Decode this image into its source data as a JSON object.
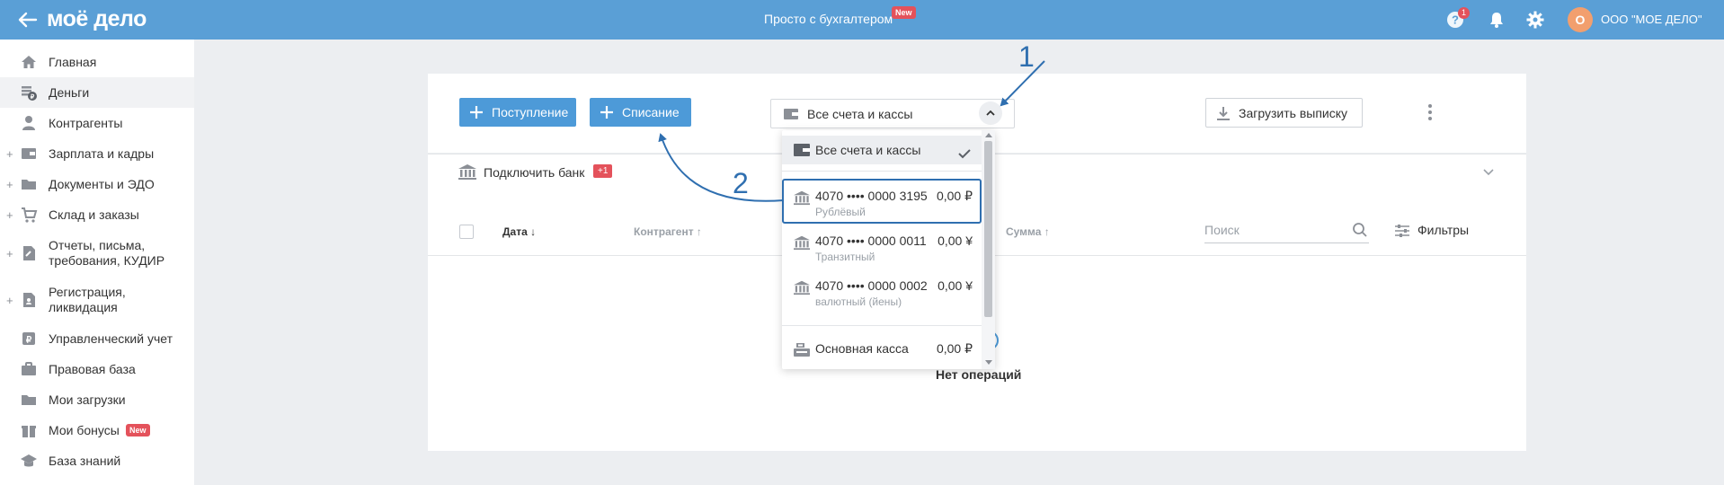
{
  "header": {
    "logo_text": "моё дело",
    "center_title": "Просто с бухгалтером",
    "center_badge": "New",
    "help_count": "1",
    "avatar_letter": "О",
    "org_name": "ООО \"МОЕ ДЕЛО\""
  },
  "sidebar": {
    "items": [
      {
        "label": "Главная",
        "icon": "home-icon"
      },
      {
        "label": "Деньги",
        "icon": "money-icon"
      },
      {
        "label": "Контрагенты",
        "icon": "contractors-icon"
      },
      {
        "label": "Зарплата и кадры",
        "icon": "payroll-icon"
      },
      {
        "label": "Документы и ЭДО",
        "icon": "documents-icon"
      },
      {
        "label": "Склад и заказы",
        "icon": "warehouse-icon"
      },
      {
        "label": "Отчеты, письма, требования, КУДИР",
        "line1": "Отчеты, письма,",
        "line2": "требования, КУДИР",
        "icon": "reports-icon"
      },
      {
        "label": "Регистрация, ликвидация",
        "line1": "Регистрация,",
        "line2": "ликвидация",
        "icon": "registration-icon"
      },
      {
        "label": "Управленческий учет",
        "icon": "management-icon"
      },
      {
        "label": "Правовая база",
        "icon": "legal-icon"
      },
      {
        "label": "Мои загрузки",
        "icon": "uploads-icon"
      },
      {
        "label": "Мои бонусы",
        "icon": "bonus-icon",
        "badge": "New"
      },
      {
        "label": "База знаний",
        "icon": "knowledge-icon"
      }
    ],
    "plus": "+"
  },
  "toolbar": {
    "income_label": "Поступление",
    "expense_label": "Списание",
    "account_select": "Все счета и кассы",
    "upload_label": "Загрузить выписку"
  },
  "bank": {
    "connect_label": "Подключить банк",
    "count_badge": "+1"
  },
  "table": {
    "columns": {
      "date": "Дата ↓",
      "contractor": "Контрагент ↑",
      "amount": "Сумма ↑"
    },
    "search_placeholder": "Поиск",
    "filters_label": "Фильтры",
    "empty_text": "Нет операций"
  },
  "dropdown": {
    "all_label": "Все счета и кассы",
    "accounts": [
      {
        "number": "4070 •••• 0000 3195",
        "type": "Рублёвый",
        "amount": "0,00 ₽"
      },
      {
        "number": "4070 •••• 0000 0011",
        "type": "Транзитный",
        "amount": "0,00 ¥"
      },
      {
        "number": "4070 •••• 0000 0002",
        "type": "валютный (йены)",
        "amount": "0,00 ¥"
      }
    ],
    "cash": {
      "name": "Основная касса",
      "amount": "0,00 ₽"
    }
  },
  "annotations": {
    "one": "1",
    "two": "2"
  },
  "colors": {
    "header_bg": "#5a9fd6",
    "primary_button": "#4d9ad8",
    "badge_red": "#e4525b",
    "annotation_blue": "#2f6fb0",
    "page_bg": "#eceef1"
  }
}
